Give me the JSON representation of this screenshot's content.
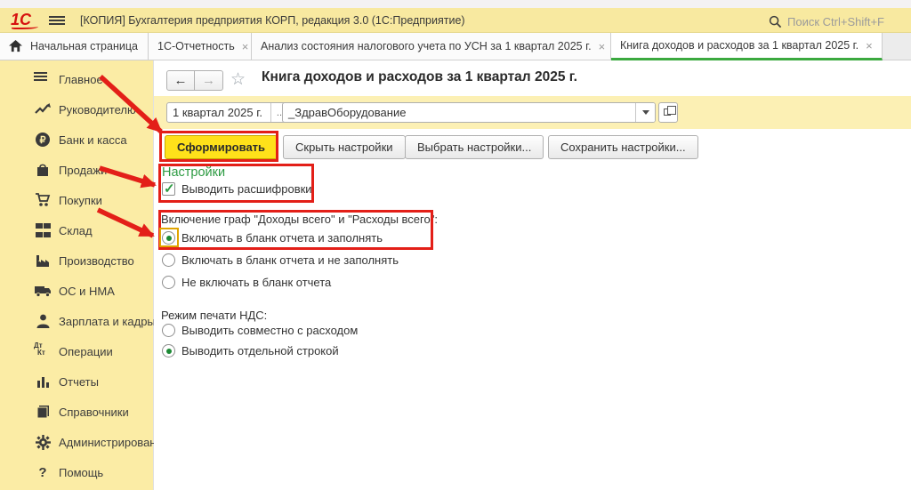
{
  "window": {
    "title": "[КОПИЯ] Бухгалтерия предприятия КОРП, редакция 3.0  (1С:Предприятие)",
    "logo_text": "1С",
    "search_placeholder": "Поиск Ctrl+Shift+F"
  },
  "tabs": [
    {
      "label": "Начальная страница",
      "icon": "home-icon",
      "closable": false,
      "active": false
    },
    {
      "label": "1С-Отчетность",
      "closable": true,
      "active": false
    },
    {
      "label": "Анализ состояния налогового учета по УСН за 1 квартал 2025 г.",
      "closable": true,
      "active": false
    },
    {
      "label": "Книга доходов и расходов за 1 квартал 2025 г.",
      "closable": true,
      "active": true
    }
  ],
  "sidebar": {
    "items": [
      {
        "label": "Главное",
        "icon": "menu-icon"
      },
      {
        "label": "Руководителю",
        "icon": "trend-chart-icon"
      },
      {
        "label": "Банк и касса",
        "icon": "ruble-coin-icon"
      },
      {
        "label": "Продажи",
        "icon": "shopping-bag-icon"
      },
      {
        "label": "Покупки",
        "icon": "shopping-cart-icon"
      },
      {
        "label": "Склад",
        "icon": "boxes-icon"
      },
      {
        "label": "Производство",
        "icon": "factory-icon"
      },
      {
        "label": "ОС и НМА",
        "icon": "truck-icon"
      },
      {
        "label": "Зарплата и кадры",
        "icon": "person-icon"
      },
      {
        "label": "Операции",
        "icon": "debit-credit-icon"
      },
      {
        "label": "Отчеты",
        "icon": "bar-chart-icon"
      },
      {
        "label": "Справочники",
        "icon": "books-icon"
      },
      {
        "label": "Администрирование",
        "icon": "gear-icon"
      },
      {
        "label": "Помощь",
        "icon": "question-icon"
      }
    ]
  },
  "report": {
    "title": "Книга доходов и расходов за 1 квартал 2025 г.",
    "period_value": "1 квартал 2025 г.",
    "organization_value": "_ЗдравОборудование",
    "buttons": {
      "generate": "Сформировать",
      "hide_settings": "Скрыть настройки",
      "choose_settings": "Выбрать настройки...",
      "save_settings": "Сохранить настройки..."
    },
    "settings": {
      "header": "Настройки",
      "checkbox_label": "Выводить расшифровки",
      "checkbox_checked": true,
      "columns_group": {
        "label": "Включение граф \"Доходы всего\" и \"Расходы всего\":",
        "options": [
          "Включать в бланк отчета и заполнять",
          "Включать в бланк отчета и не заполнять",
          "Не включать в бланк отчета"
        ],
        "selected_index": 0
      },
      "vat_group": {
        "label": "Режим печати НДС:",
        "options": [
          "Выводить совместно с расходом",
          "Выводить отдельной строкой"
        ],
        "selected_index": 1
      }
    }
  },
  "glyphs": {
    "close": "×",
    "ellipsis": "...",
    "check": "✓",
    "star": "☆",
    "back_arrow": "←",
    "forward_arrow": "→",
    "ruble": "₽",
    "dt": "Дт",
    "kt": "Кт",
    "question": "?"
  },
  "colors": {
    "titlebar_yellow": "#f8e9a0",
    "sidebar_yellow": "#fbeca5",
    "param_band_yellow": "#fcf0b4",
    "generate_button_yellow": "#ffe11a",
    "active_tab_green": "#3ba93f",
    "settings_green": "#2d9b43",
    "annotation_red": "#e31f18"
  }
}
